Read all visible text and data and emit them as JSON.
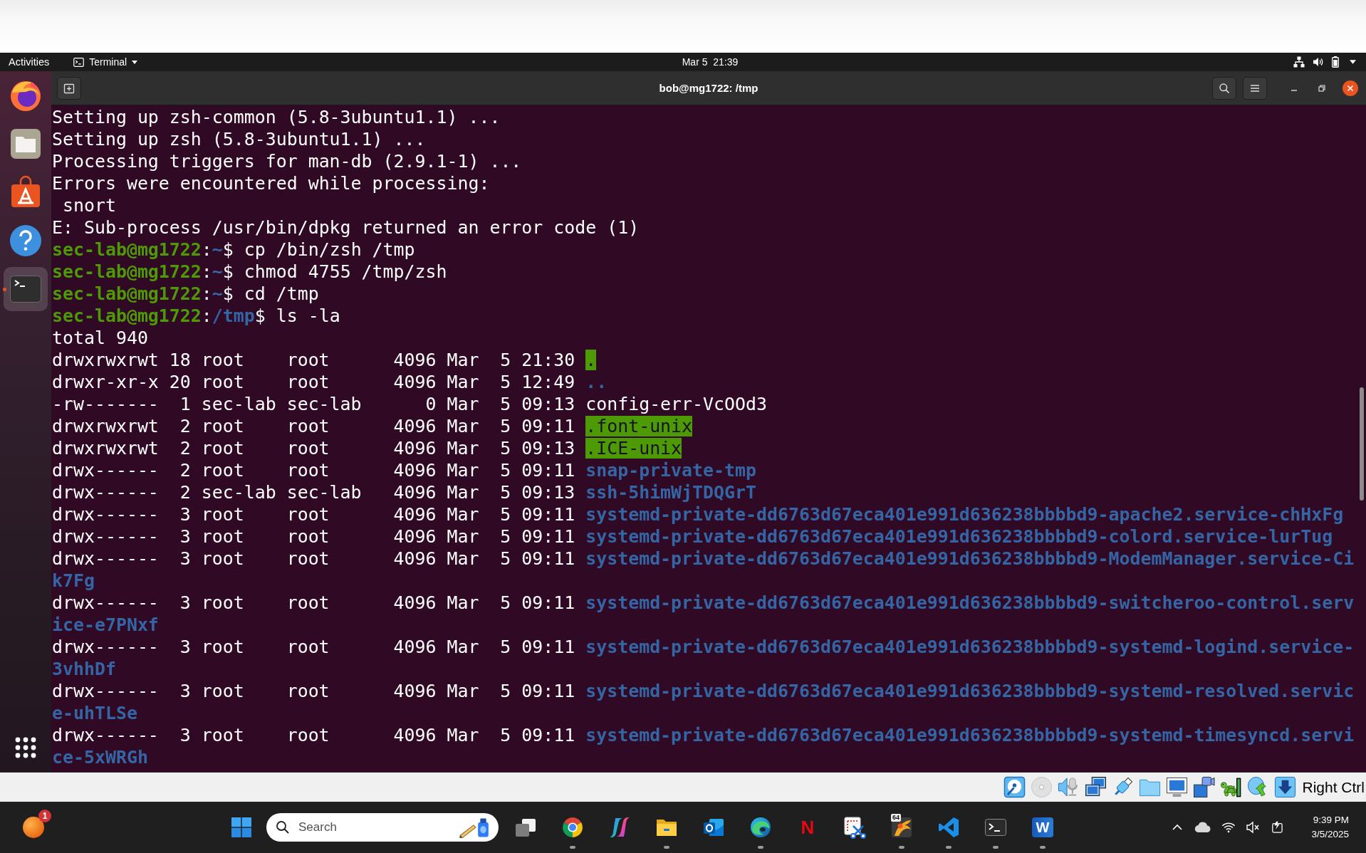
{
  "ubuntu_top_bar": {
    "activities": "Activities",
    "app_menu": "Terminal",
    "clock": "Mar 5  21:39"
  },
  "dock": {
    "apps": [
      {
        "kind": "browser",
        "selected": false,
        "running": false
      },
      {
        "kind": "files",
        "selected": false,
        "running": false
      },
      {
        "kind": "software",
        "selected": false,
        "running": false
      },
      {
        "kind": "help",
        "selected": false,
        "running": false
      },
      {
        "kind": "terminal",
        "selected": true,
        "running": true
      }
    ]
  },
  "terminal_window": {
    "title": "bob@mg1722: /tmp",
    "lines": [
      {
        "kind": "output",
        "text": "Setting up zsh-common (5.8-3ubuntu1.1) ..."
      },
      {
        "kind": "output",
        "text": "Setting up zsh (5.8-3ubuntu1.1) ..."
      },
      {
        "kind": "output",
        "text": "Processing triggers for man-db (2.9.1-1) ..."
      },
      {
        "kind": "output",
        "text": "Errors were encountered while processing:"
      },
      {
        "kind": "output",
        "text": " snort"
      },
      {
        "kind": "output",
        "text": "E: Sub-process /usr/bin/dpkg returned an error code (1)"
      },
      {
        "kind": "prompt",
        "user_host": "sec-lab@mg1722",
        "separator": ":",
        "path": "~",
        "sign": "$",
        "command": "cp /bin/zsh /tmp"
      },
      {
        "kind": "prompt",
        "user_host": "sec-lab@mg1722",
        "separator": ":",
        "path": "~",
        "sign": "$",
        "command": "chmod 4755 /tmp/zsh"
      },
      {
        "kind": "prompt",
        "user_host": "sec-lab@mg1722",
        "separator": ":",
        "path": "~",
        "sign": "$",
        "command": "cd /tmp"
      },
      {
        "kind": "prompt",
        "user_host": "sec-lab@mg1722",
        "separator": ":",
        "path": "/tmp",
        "sign": "$",
        "command": "ls -la"
      }
    ],
    "total": "total 940",
    "entries": [
      {
        "kind": "sticky-dir",
        "permissions": "drwxrwxrwt",
        "links": "18",
        "owner": "root",
        "group": "root",
        "size": "4096",
        "month": "Mar",
        "day": "5",
        "time": "21:30",
        "name": "."
      },
      {
        "kind": "dir",
        "permissions": "drwxr-xr-x",
        "links": "20",
        "owner": "root",
        "group": "root",
        "size": "4096",
        "month": "Mar",
        "day": "5",
        "time": "12:49",
        "name": ".."
      },
      {
        "kind": "file",
        "permissions": "-rw-------",
        "links": "1",
        "owner": "sec-lab",
        "group": "sec-lab",
        "size": "0",
        "month": "Mar",
        "day": "5",
        "time": "09:13",
        "name": "config-err-VcOOd3"
      },
      {
        "kind": "sticky-dir",
        "permissions": "drwxrwxrwt",
        "links": "2",
        "owner": "root",
        "group": "root",
        "size": "4096",
        "month": "Mar",
        "day": "5",
        "time": "09:11",
        "name": ".font-unix"
      },
      {
        "kind": "sticky-dir",
        "permissions": "drwxrwxrwt",
        "links": "2",
        "owner": "root",
        "group": "root",
        "size": "4096",
        "month": "Mar",
        "day": "5",
        "time": "09:13",
        "name": ".ICE-unix"
      },
      {
        "kind": "dir",
        "permissions": "drwx------",
        "links": "2",
        "owner": "root",
        "group": "root",
        "size": "4096",
        "month": "Mar",
        "day": "5",
        "time": "09:11",
        "name": "snap-private-tmp"
      },
      {
        "kind": "dir",
        "permissions": "drwx------",
        "links": "2",
        "owner": "sec-lab",
        "group": "sec-lab",
        "size": "4096",
        "month": "Mar",
        "day": "5",
        "time": "09:13",
        "name": "ssh-5himWjTDQGrT"
      },
      {
        "kind": "dir",
        "permissions": "drwx------",
        "links": "3",
        "owner": "root",
        "group": "root",
        "size": "4096",
        "month": "Mar",
        "day": "5",
        "time": "09:11",
        "name": "systemd-private-dd6763d67eca401e991d636238bbbbd9-apache2.service-chHxFg"
      },
      {
        "kind": "dir",
        "permissions": "drwx------",
        "links": "3",
        "owner": "root",
        "group": "root",
        "size": "4096",
        "month": "Mar",
        "day": "5",
        "time": "09:11",
        "name": "systemd-private-dd6763d67eca401e991d636238bbbbd9-colord.service-lurTug"
      },
      {
        "kind": "dir",
        "permissions": "drwx------",
        "links": "3",
        "owner": "root",
        "group": "root",
        "size": "4096",
        "month": "Mar",
        "day": "5",
        "time": "09:11",
        "name": "systemd-private-dd6763d67eca401e991d636238bbbbd9-ModemManager.service-Cik7Fg"
      },
      {
        "kind": "dir",
        "permissions": "drwx------",
        "links": "3",
        "owner": "root",
        "group": "root",
        "size": "4096",
        "month": "Mar",
        "day": "5",
        "time": "09:11",
        "name": "systemd-private-dd6763d67eca401e991d636238bbbbd9-switcheroo-control.service-e7PNxf"
      },
      {
        "kind": "dir",
        "permissions": "drwx------",
        "links": "3",
        "owner": "root",
        "group": "root",
        "size": "4096",
        "month": "Mar",
        "day": "5",
        "time": "09:11",
        "name": "systemd-private-dd6763d67eca401e991d636238bbbbd9-systemd-logind.service-3vhhDf"
      },
      {
        "kind": "dir",
        "permissions": "drwx------",
        "links": "3",
        "owner": "root",
        "group": "root",
        "size": "4096",
        "month": "Mar",
        "day": "5",
        "time": "09:11",
        "name": "systemd-private-dd6763d67eca401e991d636238bbbbd9-systemd-resolved.service-uhTLSe"
      },
      {
        "kind": "dir",
        "permissions": "drwx------",
        "links": "3",
        "owner": "root",
        "group": "root",
        "size": "4096",
        "month": "Mar",
        "day": "5",
        "time": "09:11",
        "name": "systemd-private-dd6763d67eca401e991d636238bbbbd9-systemd-timesyncd.service-5xWRGh"
      }
    ]
  },
  "vm_status_bar": {
    "host_key": "Right Ctrl"
  },
  "taskbar": {
    "widget_badge": "1",
    "search": {
      "placeholder": "Search"
    },
    "apps": [
      {
        "kind": "start",
        "running": false
      },
      {
        "kind": "taskview",
        "running": false
      },
      {
        "kind": "chrome",
        "running": true
      },
      {
        "kind": "copilot",
        "running": false
      },
      {
        "kind": "explorer",
        "running": true
      },
      {
        "kind": "outlook",
        "running": false
      },
      {
        "kind": "edge",
        "running": true
      },
      {
        "kind": "netflix",
        "letter": "N",
        "running": false
      },
      {
        "kind": "snipping",
        "running": false
      },
      {
        "kind": "app64",
        "badge": "64",
        "running": true
      },
      {
        "kind": "vscode",
        "running": true
      },
      {
        "kind": "terminal",
        "running": true
      },
      {
        "kind": "word",
        "letter": "W",
        "running": true
      }
    ],
    "tray": {
      "muted": true
    },
    "clock": {
      "time": "9:39 PM",
      "date": "3/5/2025"
    }
  }
}
